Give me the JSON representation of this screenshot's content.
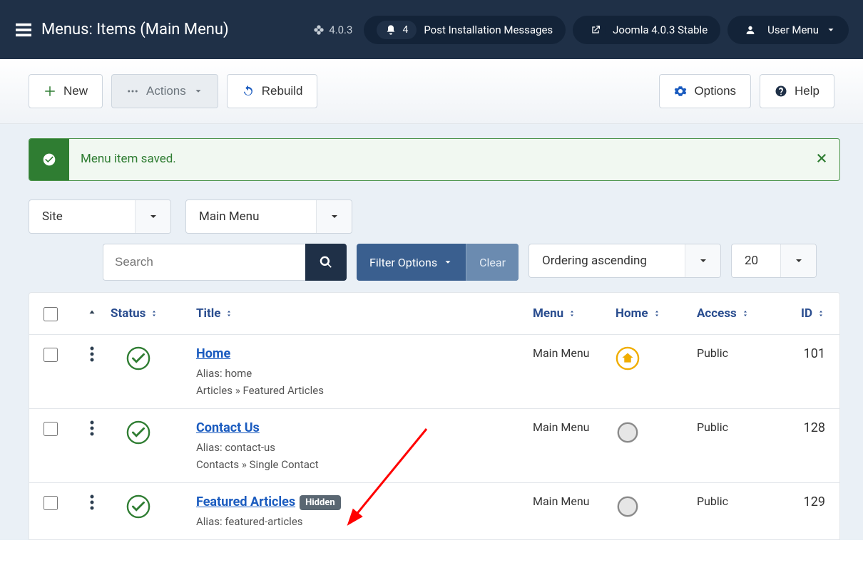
{
  "header": {
    "title": "Menus: Items (Main Menu)",
    "version": "4.0.3",
    "notif_count": "4",
    "post_install": "Post Installation Messages",
    "stable": "Joomla 4.0.3 Stable",
    "user_menu": "User Menu"
  },
  "toolbar": {
    "new": "New",
    "actions": "Actions",
    "rebuild": "Rebuild",
    "options": "Options",
    "help": "Help"
  },
  "alert": {
    "text": "Menu item saved."
  },
  "filters": {
    "client": "Site",
    "menu": "Main Menu",
    "search_placeholder": "Search",
    "filter_options": "Filter Options",
    "clear": "Clear",
    "ordering": "Ordering ascending",
    "limit": "20"
  },
  "columns": {
    "status": "Status",
    "title": "Title",
    "menu": "Menu",
    "home": "Home",
    "access": "Access",
    "id": "ID"
  },
  "rows": [
    {
      "title": "Home",
      "alias": "Alias: home",
      "type": "Articles » Featured Articles",
      "menu": "Main Menu",
      "home": "star",
      "access": "Public",
      "id": "101",
      "hidden": false
    },
    {
      "title": "Contact Us",
      "alias": "Alias: contact-us",
      "type": "Contacts » Single Contact",
      "menu": "Main Menu",
      "home": "empty",
      "access": "Public",
      "id": "128",
      "hidden": false
    },
    {
      "title": "Featured Articles",
      "alias": "Alias: featured-articles",
      "type": "",
      "menu": "Main Menu",
      "home": "empty",
      "access": "Public",
      "id": "129",
      "hidden": true,
      "hidden_label": "Hidden"
    }
  ]
}
